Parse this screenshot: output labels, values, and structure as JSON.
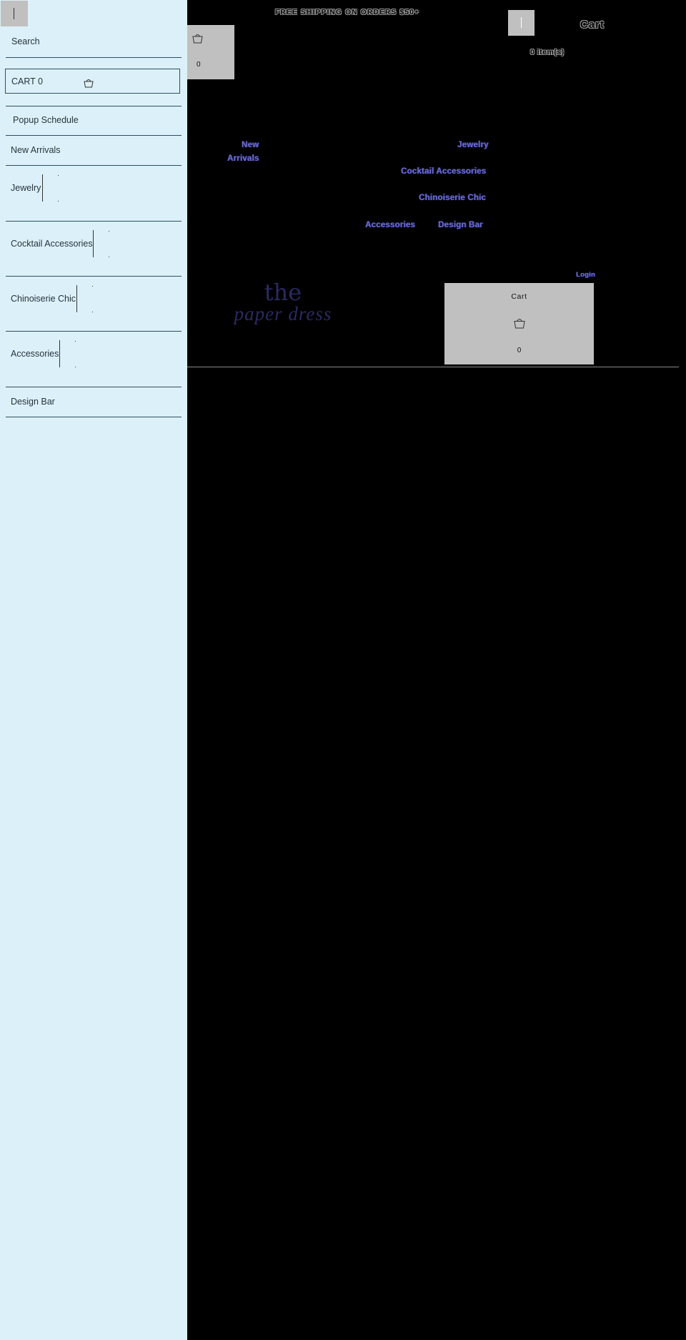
{
  "drawer": {
    "search_label": "Search",
    "cart_label": "CART 0",
    "items": [
      {
        "label": "Popup Schedule"
      },
      {
        "label": "New Arrivals"
      },
      {
        "label": "Jewelry"
      },
      {
        "label": "Cocktail Accessories"
      },
      {
        "label": "Chinoiserie Chic"
      },
      {
        "label": "Accessories"
      },
      {
        "label": "Design Bar"
      }
    ]
  },
  "header": {
    "announcement": "FREE SHIPPING ON ORDERS $50+",
    "cart_count_top": "0",
    "ghost_cart": "Cart",
    "items_count": "0 item(s)"
  },
  "nav": {
    "new": "New",
    "arrivals": "Arrivals",
    "jewelry": "Jewelry",
    "cocktail": "Cocktail Accessories",
    "chinoiserie": "Chinoiserie Chic",
    "accessories": "Accessories",
    "design_bar": "Design Bar",
    "login": "Login"
  },
  "logo": {
    "line1": "the",
    "line2": "paper dress"
  },
  "cart_card": {
    "title": "Cart",
    "count": "0"
  },
  "colors": {
    "drawer_bg": "#dcf0f9",
    "nav_text": "#6c6cd0",
    "logo": "#2a2a62",
    "tile": "#c0c0c0"
  }
}
